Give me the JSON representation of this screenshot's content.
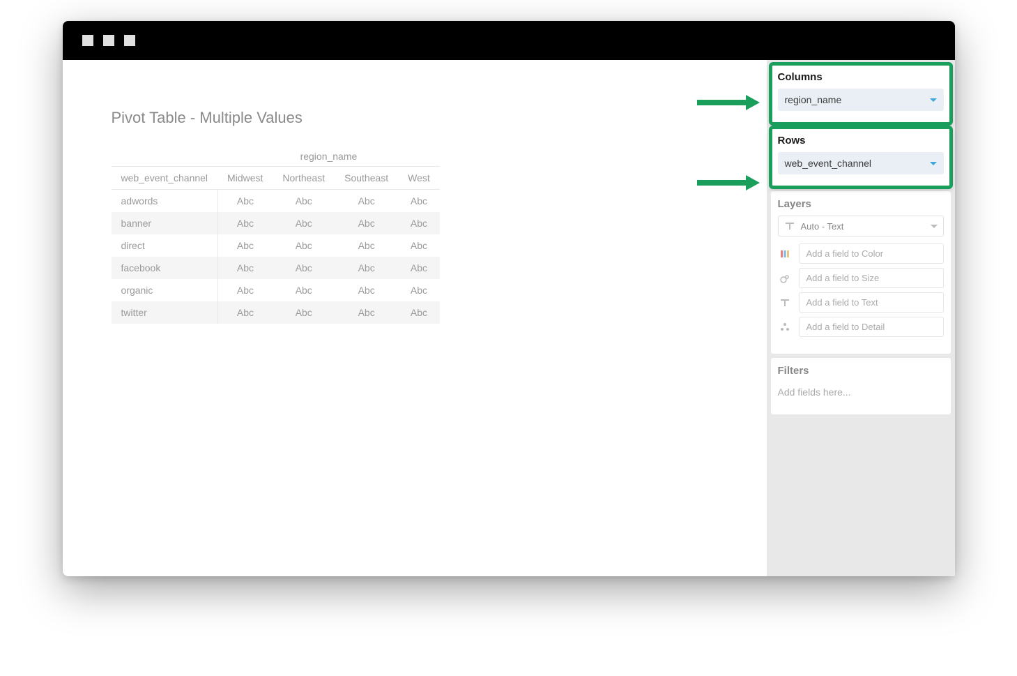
{
  "title": "Pivot Table - Multiple Values",
  "columns_panel": {
    "heading": "Columns",
    "pill": "region_name"
  },
  "rows_panel": {
    "heading": "Rows",
    "pill": "web_event_channel"
  },
  "layers_panel": {
    "heading": "Layers",
    "selector": "Auto - Text",
    "slots": {
      "color": "Add a field to Color",
      "size": "Add a field to Size",
      "text": "Add a field to Text",
      "detail": "Add a field to Detail"
    }
  },
  "filters_panel": {
    "heading": "Filters",
    "placeholder": "Add fields here..."
  },
  "table": {
    "top_header": "region_name",
    "row_header": "web_event_channel",
    "columns": [
      "Midwest",
      "Northeast",
      "Southeast",
      "West"
    ],
    "rows": [
      "adwords",
      "banner",
      "direct",
      "facebook",
      "organic",
      "twitter"
    ],
    "cell_value": "Abc"
  },
  "chart_data": {
    "type": "table",
    "title": "Pivot Table - Multiple Values",
    "column_field": "region_name",
    "row_field": "web_event_channel",
    "columns": [
      "Midwest",
      "Northeast",
      "Southeast",
      "West"
    ],
    "rows": [
      "adwords",
      "banner",
      "direct",
      "facebook",
      "organic",
      "twitter"
    ],
    "cells_placeholder": "Abc"
  }
}
